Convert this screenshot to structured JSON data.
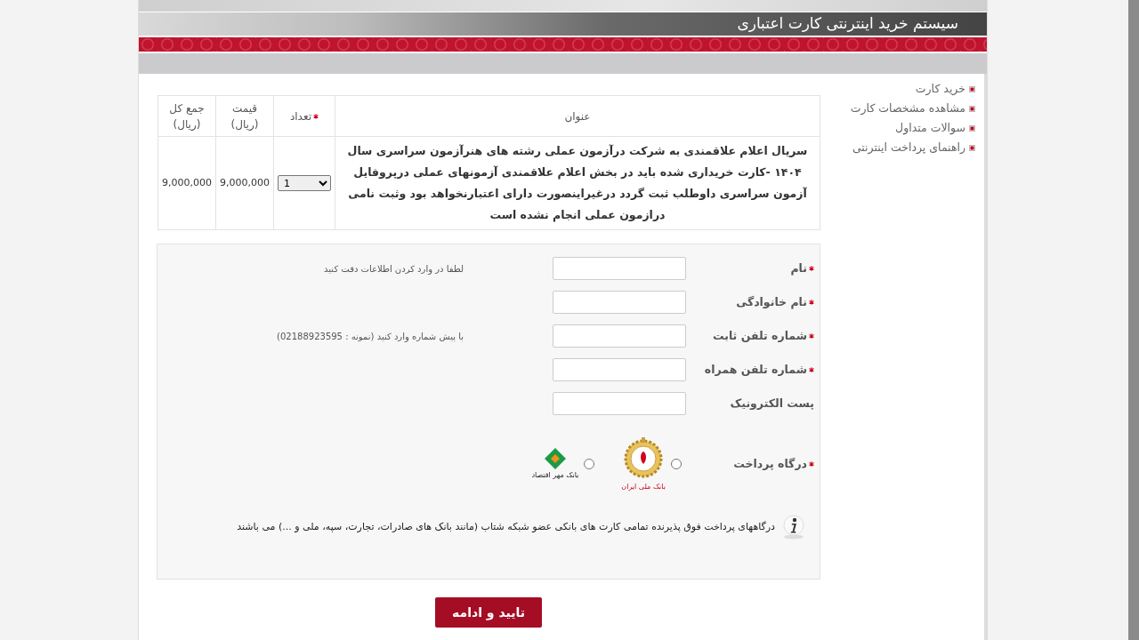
{
  "header": {
    "title": "سیستم خرید اینترنتی کارت اعتباری"
  },
  "sidebar": {
    "items": [
      {
        "label": "خرید کارت"
      },
      {
        "label": "مشاهده مشخصات کارت"
      },
      {
        "label": "سوالات متداول"
      },
      {
        "label": "راهنمای پرداخت اینترنتی"
      }
    ]
  },
  "table": {
    "columns": [
      {
        "label": "عنوان",
        "required": false
      },
      {
        "label": "تعداد",
        "required": true
      },
      {
        "label": "قیمت",
        "unit": "(ریال)",
        "required": false
      },
      {
        "label": "جمع کل",
        "unit": "(ریال)",
        "required": false
      }
    ],
    "rows": [
      {
        "title": "سریال اعلام علاقمندی به شرکت درآزمون عملی رشته های هنرآزمون سراسری سال ۱۴۰۴ -کارت خریداری شده باید در بخش اعلام علاقمندی آزمونهای عملی درپروفایل آزمون سراسری داوطلب ثبت گردد درغیراینصورت دارای اعتبارنخواهد بود وثبت نامی درازمون عملی انجام نشده است",
        "quantity": "1",
        "price": "9,000,000",
        "total": "9,000,000"
      }
    ]
  },
  "form": {
    "fields": [
      {
        "label": "نام",
        "required": true,
        "hint": "لطفا در وارد کردن اطلاعات دقت کنید"
      },
      {
        "label": "نام خانوادگی",
        "required": true
      },
      {
        "label": "شماره تلفن ثابت",
        "required": true,
        "hint": "با پیش شماره وارد کنید (نمونه : 02188923595)"
      },
      {
        "label": "شماره تلفن همراه",
        "required": true
      },
      {
        "label": "پست الکترونیک",
        "required": false
      }
    ],
    "gateway": {
      "label": "درگاه پرداخت",
      "required": true,
      "options": [
        {
          "kind": "melli",
          "logo_text": "بانک ملی ایران",
          "selected": false
        },
        {
          "kind": "mehr",
          "logo_text": "بانک مهر اقتصاد",
          "selected": false
        }
      ]
    },
    "note": "درگاههای پرداخت فوق پذیرنده تمامی کارت های بانکی عضو شبکه شتاب (مانند بانک های صادرات، تجارت، سپه، ملی و ...) می باشند"
  },
  "submit_button": "تایید و ادامه"
}
